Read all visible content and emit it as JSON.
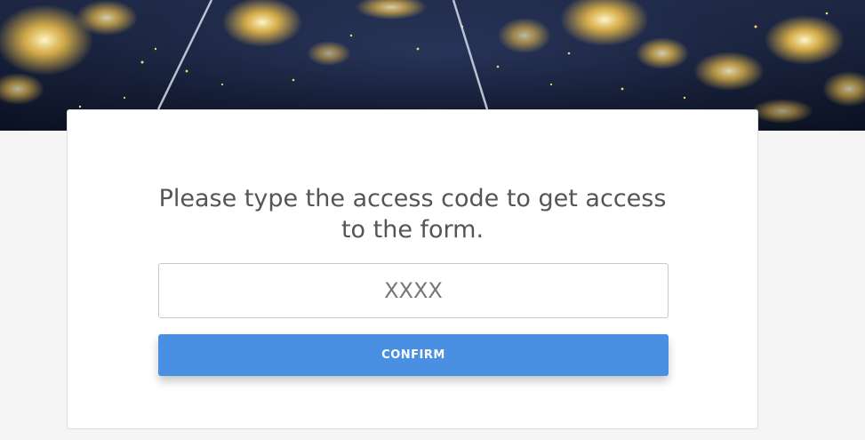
{
  "banner": {
    "description_icon": "earth-night-lights-image"
  },
  "access_form": {
    "prompt": "Please type the access code to get access to the form.",
    "code_input": {
      "value": "",
      "placeholder": "XXXX"
    },
    "confirm_label": "CONFIRM"
  },
  "colors": {
    "accent": "#4a90e2",
    "page_background": "#f5f5f5",
    "card_background": "#ffffff",
    "text": "#555555"
  }
}
